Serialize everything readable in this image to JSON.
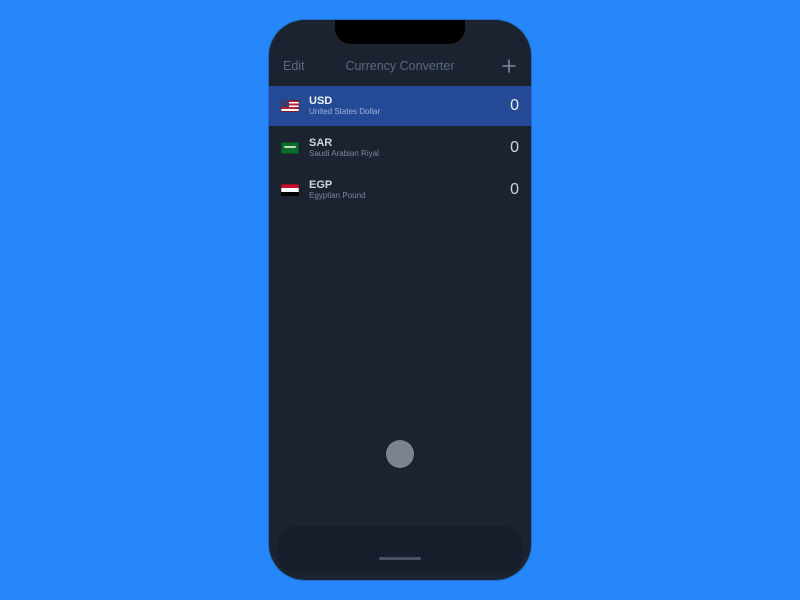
{
  "navbar": {
    "edit_label": "Edit",
    "title": "Currency Converter",
    "add_label": "+"
  },
  "currencies": [
    {
      "code": "USD",
      "name": "United States Dollar",
      "value": "0",
      "flag": "us",
      "selected": true
    },
    {
      "code": "SAR",
      "name": "Saudi Arabian Riyal",
      "value": "0",
      "flag": "sa",
      "selected": false
    },
    {
      "code": "EGP",
      "name": "Egyptian Pound",
      "value": "0",
      "flag": "eg",
      "selected": false
    }
  ],
  "colors": {
    "stage_bg": "#2687fb",
    "phone_bg": "#1b2230",
    "selected_row_bg": "#244a95"
  }
}
